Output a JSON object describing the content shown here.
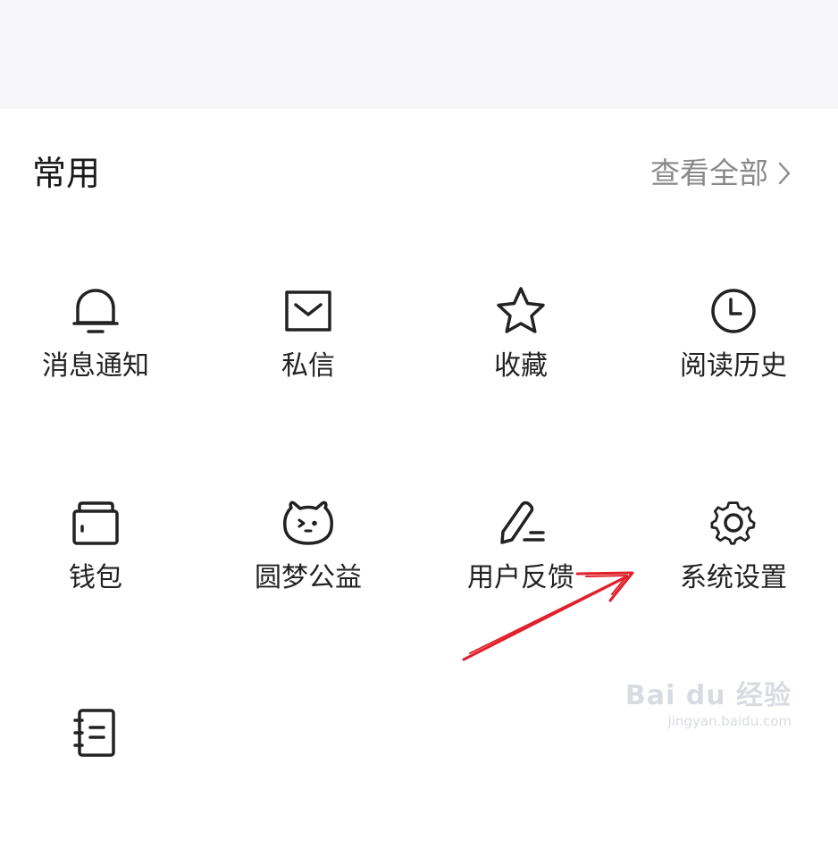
{
  "section": {
    "title": "常用",
    "view_all_label": "查看全部",
    "view_all_icon": "chevron-right-icon"
  },
  "items": [
    {
      "label": "消息通知",
      "icon": "bell-icon"
    },
    {
      "label": "私信",
      "icon": "envelope-icon"
    },
    {
      "label": "收藏",
      "icon": "star-icon"
    },
    {
      "label": "阅读历史",
      "icon": "clock-icon"
    },
    {
      "label": "钱包",
      "icon": "wallet-icon"
    },
    {
      "label": "圆梦公益",
      "icon": "cat-face-icon"
    },
    {
      "label": "用户反馈",
      "icon": "pencil-icon"
    },
    {
      "label": "系统设置",
      "icon": "gear-icon"
    },
    {
      "label": "",
      "icon": "notebook-icon"
    }
  ],
  "annotation": {
    "color": "#e0202a",
    "target": "系统设置"
  },
  "watermark": {
    "main": "Bai du 经验",
    "sub": "jingyan.baidu.com"
  }
}
